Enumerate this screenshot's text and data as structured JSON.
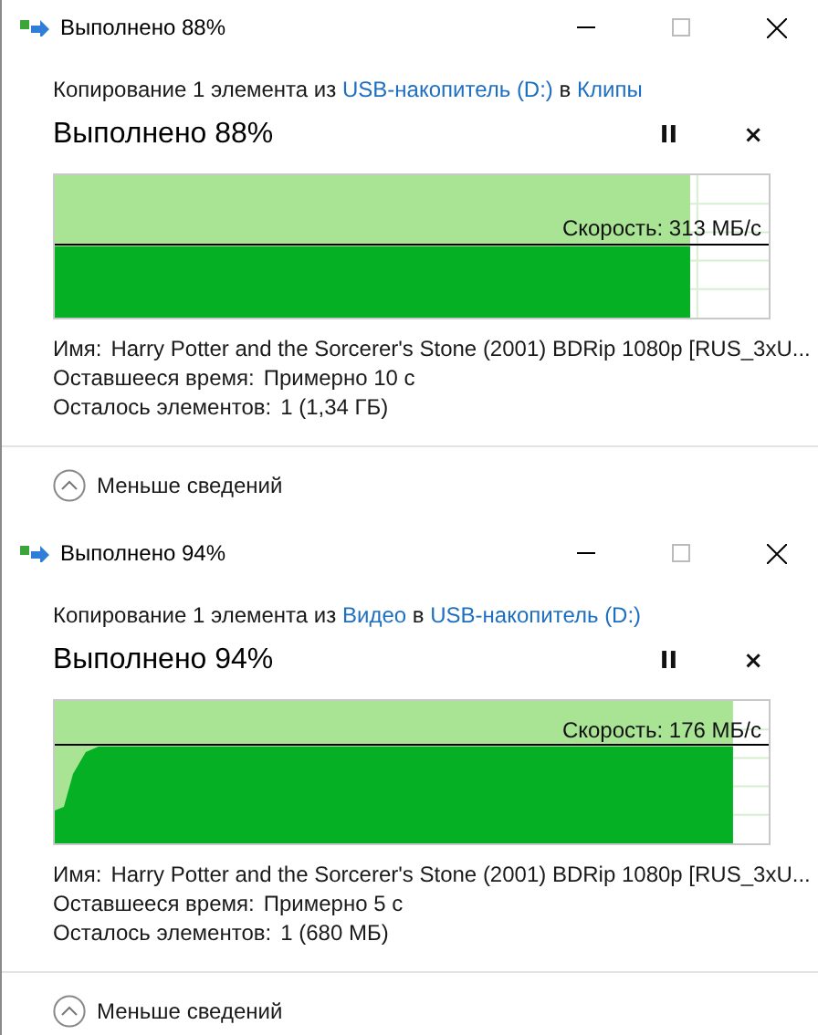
{
  "dialogs": [
    {
      "title": "Выполнено 88%",
      "copy_line": [
        {
          "kind": "text",
          "text": "Копирование 1 элемента из"
        },
        {
          "kind": "link",
          "text": "USB-накопитель (D:)"
        },
        {
          "kind": "text",
          "text": "в"
        },
        {
          "kind": "link",
          "text": "Клипы"
        }
      ],
      "heading": "Выполнено 88%",
      "pause": "II",
      "cancel": "×",
      "progress": {
        "level": 0.89
      },
      "graph": {
        "kind": "flat"
      },
      "speed": "Скорость: 313 МБ/с",
      "details": [
        {
          "label": "Имя:",
          "value": "Harry Potter and the Sorcerer's Stone (2001) BDRip 1080p [RUS_3xU..."
        },
        {
          "label": "Оставшееся время:",
          "value": "Примерно 10 с"
        },
        {
          "label": "Осталось элементов:",
          "value": "1 (1,34 ГБ)"
        }
      ],
      "less": "Меньше сведений"
    },
    {
      "title": "Выполнено 94%",
      "copy_line": [
        {
          "kind": "text",
          "text": "Копирование 1 элемента из"
        },
        {
          "kind": "link",
          "text": "Видео"
        },
        {
          "kind": "text",
          "text": "в"
        },
        {
          "kind": "link",
          "text": "USB-накопитель (D:)"
        }
      ],
      "heading": "Выполнено 94%",
      "pause": "II",
      "cancel": "×",
      "progress": {
        "level": 0.95
      },
      "graph": {
        "kind": "ramp"
      },
      "speed": "Скорость: 176 МБ/с",
      "details": [
        {
          "label": "Имя:",
          "value": "Harry Potter and the Sorcerer's Stone (2001) BDRip 1080p [RUS_3xU..."
        },
        {
          "label": "Оставшееся время:",
          "value": "Примерно 5 с"
        },
        {
          "label": "Осталось элементов:",
          "value": "1 (680 МБ)"
        }
      ],
      "less": "Меньше сведений"
    }
  ]
}
